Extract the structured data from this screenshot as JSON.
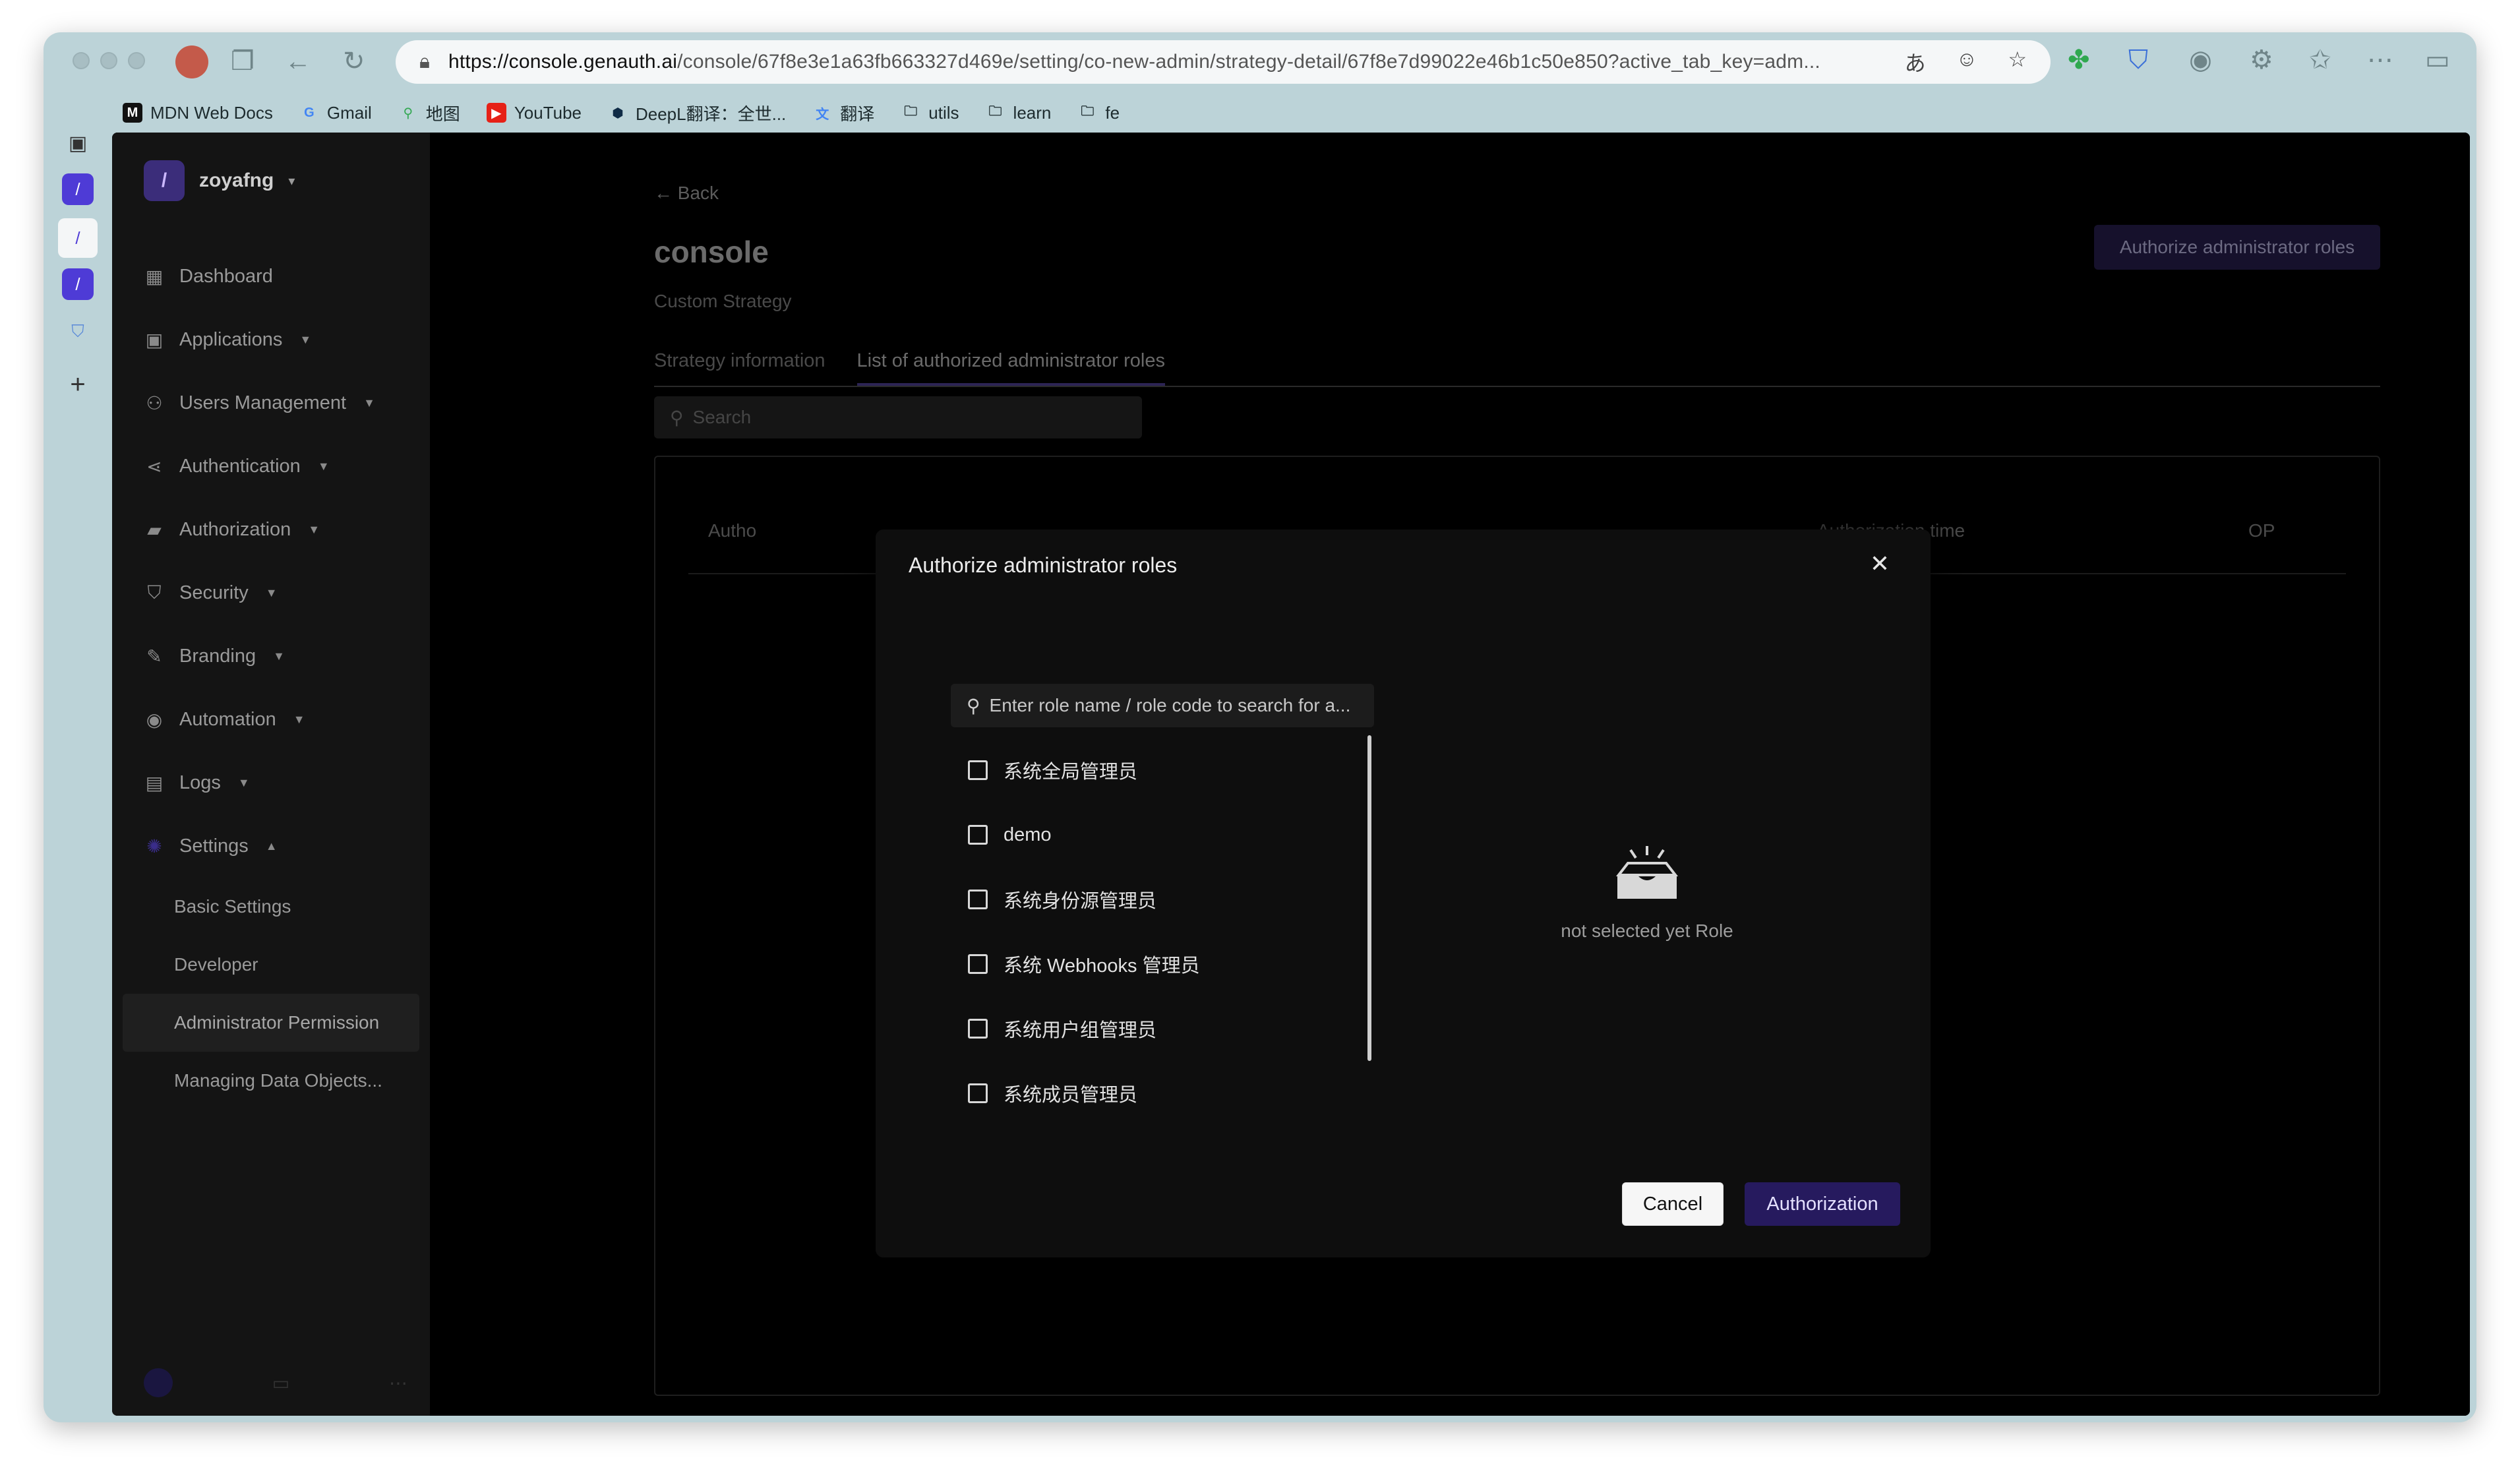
{
  "browser": {
    "url_domain": "https://console.genauth.ai",
    "url_path": "/console/67f8e3e1a63fb663327d469e/setting/co-new-admin/strategy-detail/67f8e7d99022e46b1c50e850?active_tab_key=adm...",
    "bookmarks": [
      {
        "label": "MDN Web Docs",
        "icon": "mdn-icon",
        "color": "#111111"
      },
      {
        "label": "Gmail",
        "icon": "google-icon",
        "color": "#4285f4"
      },
      {
        "label": "地图",
        "icon": "map-pin-icon",
        "color": "#34a853"
      },
      {
        "label": "YouTube",
        "icon": "youtube-icon",
        "color": "#e62117"
      },
      {
        "label": "DeepL翻译：全世...",
        "icon": "deepl-icon",
        "color": "#0f2b46"
      },
      {
        "label": "翻译",
        "icon": "translate-icon",
        "color": "#4285f4"
      },
      {
        "label": "utils",
        "icon": "folder-icon",
        "color": "#1d2b2e"
      },
      {
        "label": "learn",
        "icon": "folder-icon",
        "color": "#1d2b2e"
      },
      {
        "label": "fe",
        "icon": "folder-icon",
        "color": "#1d2b2e"
      }
    ]
  },
  "sidebar": {
    "org_name": "zoyafng",
    "items": [
      {
        "label": "Dashboard",
        "icon": "dashboard-icon",
        "glyph": "▦",
        "has_caret": false
      },
      {
        "label": "Applications",
        "icon": "applications-icon",
        "glyph": "▣",
        "has_caret": true
      },
      {
        "label": "Users Management",
        "icon": "user-icon",
        "glyph": "⚇",
        "has_caret": true
      },
      {
        "label": "Authentication",
        "icon": "share-icon",
        "glyph": "⋖",
        "has_caret": true
      },
      {
        "label": "Authorization",
        "icon": "lock-icon",
        "glyph": "▰",
        "has_caret": true
      },
      {
        "label": "Security",
        "icon": "shield-icon",
        "glyph": "⛉",
        "has_caret": true
      },
      {
        "label": "Branding",
        "icon": "brush-icon",
        "glyph": "✎",
        "has_caret": true
      },
      {
        "label": "Automation",
        "icon": "automation-icon",
        "glyph": "◉",
        "has_caret": true
      },
      {
        "label": "Logs",
        "icon": "logs-icon",
        "glyph": "▤",
        "has_caret": true
      },
      {
        "label": "Settings",
        "icon": "settings-icon",
        "glyph": "✺",
        "has_caret": true
      }
    ],
    "settings_sub": [
      {
        "label": "Basic Settings",
        "active": false
      },
      {
        "label": "Developer",
        "active": false
      },
      {
        "label": "Administrator Permission",
        "active": true
      },
      {
        "label": "Managing Data Objects...",
        "active": false
      }
    ]
  },
  "page": {
    "back_label": "Back",
    "title": "console",
    "subtitle": "Custom Strategy",
    "top_button": "Authorize administrator roles",
    "tabs": [
      "Strategy information",
      "List of authorized administrator roles"
    ],
    "search_placeholder": "Search",
    "table_headers": {
      "col1": "Autho",
      "time": "Authorization time",
      "op": "OP"
    }
  },
  "modal": {
    "title": "Authorize administrator roles",
    "search_placeholder": "Enter role name / role code to search for a...",
    "roles": [
      "系统全局管理员",
      "demo",
      "系统身份源管理员",
      "系统 Webhooks 管理员",
      "系统用户组管理员",
      "系统成员管理员"
    ],
    "empty_text": "not selected yet Role",
    "cancel_label": "Cancel",
    "confirm_label": "Authorization"
  },
  "colors": {
    "accent": "#261a5e",
    "sidebar_bg": "#141414",
    "modal_bg": "#0e0e0e"
  }
}
